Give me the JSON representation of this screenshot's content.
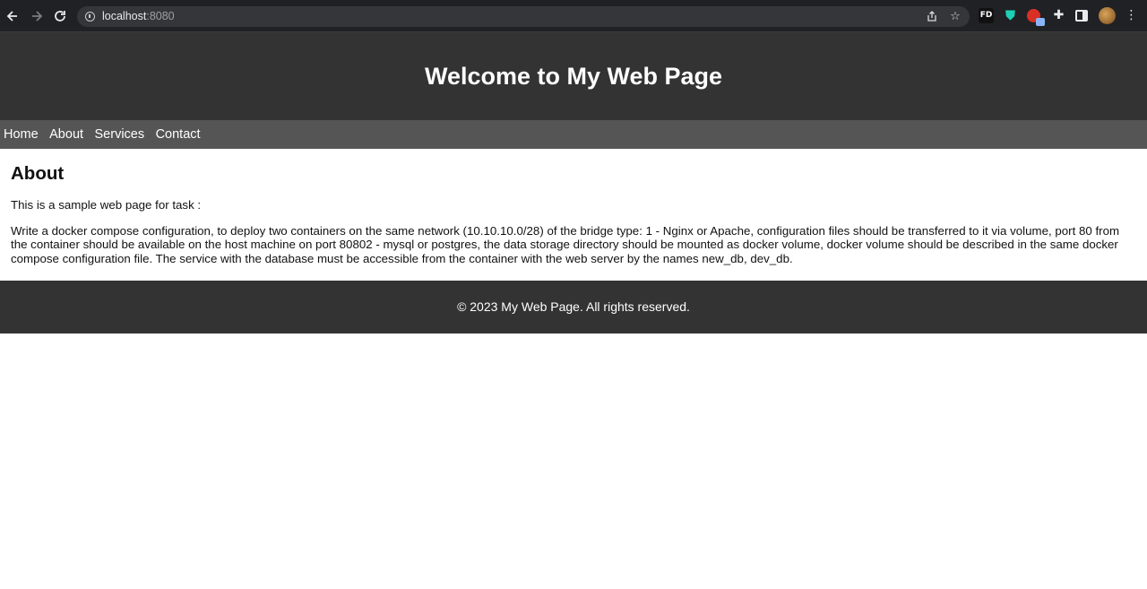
{
  "browser": {
    "url_host": "localhost",
    "url_port": ":8080",
    "nav_icons": {
      "back": "arrow-left-icon",
      "forward": "arrow-right-icon",
      "reload": "reload-icon"
    },
    "extension_fd_label": "FD"
  },
  "header": {
    "title": "Welcome to My Web Page"
  },
  "nav": {
    "items": [
      {
        "label": "Home"
      },
      {
        "label": "About"
      },
      {
        "label": "Services"
      },
      {
        "label": "Contact"
      }
    ]
  },
  "main": {
    "heading": "About",
    "intro": "This is a sample web page for task :",
    "task": "Write a docker compose configuration, to deploy two containers on the same network (10.10.10.0/28) of the bridge type: 1 - Nginx or Apache, configuration files should be transferred to it via volume, port 80 from the container should be available on the host machine on port 80802 - mysql or postgres, the data storage directory should be mounted as docker volume, docker volume should be described in the same docker compose configuration file. The service with the database must be accessible from the container with the web server by the names new_db, dev_db."
  },
  "footer": {
    "text": "© 2023 My Web Page. All rights reserved."
  },
  "colors": {
    "chrome_bg": "#202124",
    "omnibox_bg": "#35363a",
    "header_bg": "#333333",
    "nav_bg": "#555555",
    "footer_bg": "#333333"
  }
}
